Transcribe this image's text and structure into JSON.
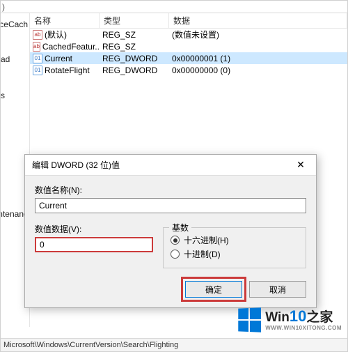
{
  "menu_remnant": ")",
  "tree": {
    "items": [
      "aceCach",
      "ad",
      "s",
      "ntenanc"
    ]
  },
  "columns": {
    "name": "名称",
    "type": "类型",
    "data": "数据"
  },
  "rows": [
    {
      "name": "(默认)",
      "type": "REG_SZ",
      "data": "(数值未设置)",
      "icon": "str",
      "selected": false
    },
    {
      "name": "CachedFeatur...",
      "type": "REG_SZ",
      "data": "",
      "icon": "str",
      "selected": false
    },
    {
      "name": "Current",
      "type": "REG_DWORD",
      "data": "0x00000001 (1)",
      "icon": "bin",
      "selected": true
    },
    {
      "name": "RotateFlight",
      "type": "REG_DWORD",
      "data": "0x00000000 (0)",
      "icon": "bin",
      "selected": false
    }
  ],
  "dialog": {
    "title": "编辑 DWORD (32 位)值",
    "name_label": "数值名称(N):",
    "name_value": "Current",
    "value_label": "数值数据(V):",
    "value_value": "0",
    "radix_label": "基数",
    "radix_hex": "十六进制(H)",
    "radix_dec": "十进制(D)",
    "ok": "确定",
    "cancel": "取消"
  },
  "watermark": {
    "brand_prefix": "Win",
    "brand_accent": "10",
    "brand_suffix": "之家",
    "url": "WWW.WIN10XITONG.COM"
  },
  "statusbar": "Microsoft\\Windows\\CurrentVersion\\Search\\Flighting"
}
